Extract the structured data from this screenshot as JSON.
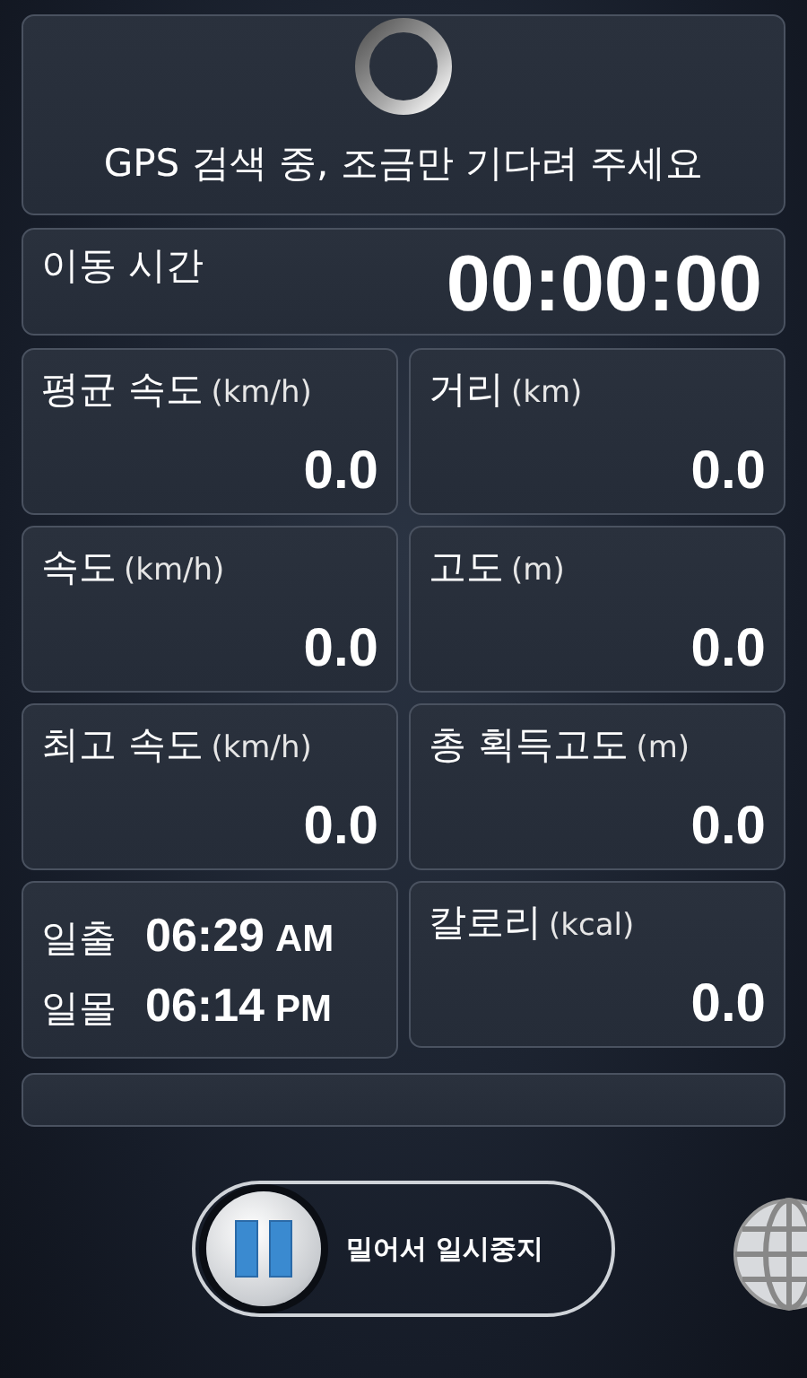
{
  "gps_status": {
    "message": "GPS 검색 중, 조금만 기다려 주세요"
  },
  "moving_time": {
    "label": "이동 시간",
    "value": "00:00:00"
  },
  "stats": [
    {
      "name": "평균 속도",
      "unit": "(km/h)",
      "value": "0.0"
    },
    {
      "name": "거리",
      "unit": "(km)",
      "value": "0.0"
    },
    {
      "name": "속도",
      "unit": "(km/h)",
      "value": "0.0"
    },
    {
      "name": "고도",
      "unit": "(m)",
      "value": "0.0"
    },
    {
      "name": "최고 속도",
      "unit": "(km/h)",
      "value": "0.0"
    },
    {
      "name": "총 획득고도",
      "unit": "(m)",
      "value": "0.0"
    }
  ],
  "sun": [
    {
      "label": "일출",
      "time": "06:29",
      "period": "AM"
    },
    {
      "label": "일몰",
      "time": "06:14",
      "period": "PM"
    }
  ],
  "calories": {
    "name": "칼로리",
    "unit": "(kcal)",
    "value": "0.0"
  },
  "pause_slider": {
    "label": "밀어서 일시중지"
  }
}
